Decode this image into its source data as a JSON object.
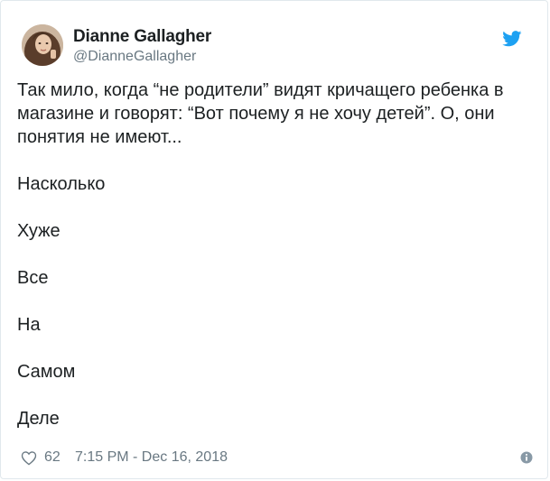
{
  "author": {
    "name": "Dianne Gallagher",
    "handle": "@DianneGallagher",
    "avatar_icon": "avatar-photo"
  },
  "brand": {
    "icon": "twitter-bird-icon",
    "color": "#1da1f2"
  },
  "tweet": {
    "paragraph": "Так мило, когда “не родители” видят кричащего ребенка в магазине и говорят: “Вот почему я не хочу детей”. О, они понятия не имеют...",
    "lines": [
      "Насколько",
      "Хуже",
      "Все",
      "На",
      "Самом",
      "Деле"
    ]
  },
  "footer": {
    "likes": "62",
    "timestamp": "7:15 PM - Dec 16, 2018",
    "like_icon": "heart-icon",
    "info_icon": "info-icon",
    "muted_color": "#697882"
  }
}
